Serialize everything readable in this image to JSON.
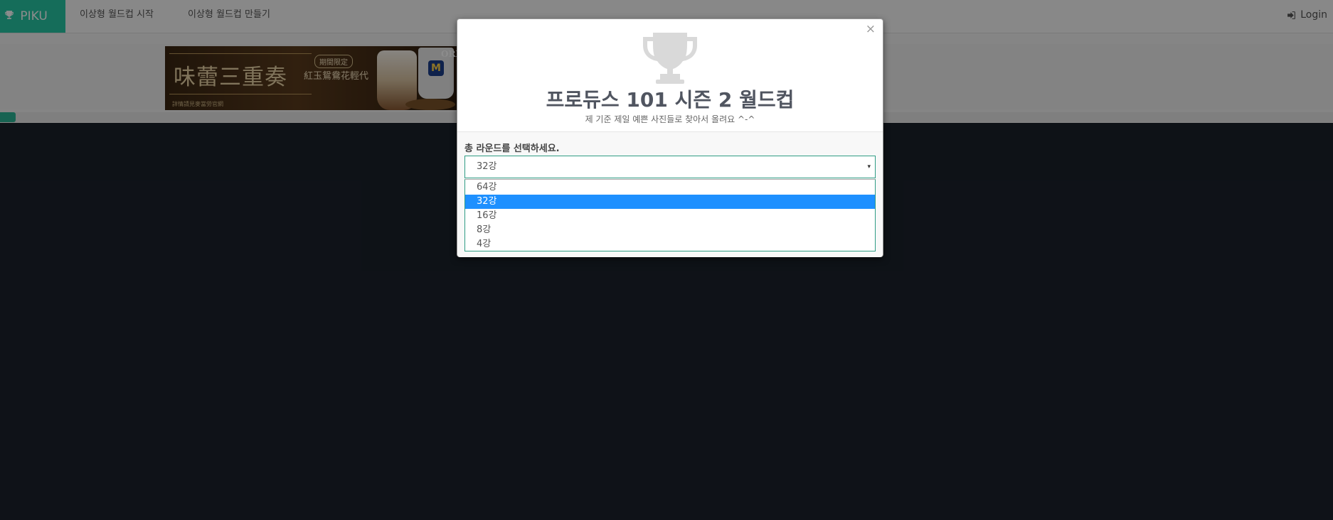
{
  "navbar": {
    "brand": "PIKU",
    "links": [
      "이상형 월드컵 시작",
      "이상형 월드컵 만들기"
    ],
    "login": "Login"
  },
  "ad": {
    "title": "味蕾三重奏",
    "badge": "期間限定",
    "product": "紅玉鴛鴦花輕代",
    "brand": "ORE",
    "footnote": "詳情請見麥當勞官網"
  },
  "modal": {
    "close": "×",
    "title": "프로듀스 101 시즌 2 월드컵",
    "subtitle": "제 기준 제일 예쁜 사진들로 찾아서 올려요 ^-^",
    "round_label": "총 라운드를 선택하세요.",
    "round_select": {
      "value": "32강",
      "caret": "▾",
      "options": [
        "64강",
        "32강",
        "16강",
        "8강",
        "4강"
      ]
    }
  },
  "colors": {
    "brand": "#27c7a5",
    "select_border": "#2f9c84",
    "option_highlight": "#1e90ff",
    "background": "#1b212b"
  }
}
